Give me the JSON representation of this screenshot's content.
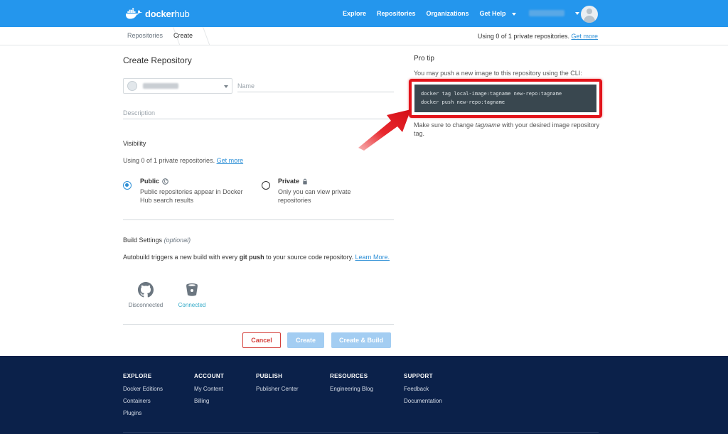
{
  "app": {
    "brand_bold": "docker",
    "brand_light": "hub"
  },
  "nav": {
    "links": [
      "Explore",
      "Repositories",
      "Organizations",
      "Get Help"
    ]
  },
  "breadcrumb": {
    "items": [
      "Repositories",
      "Create"
    ]
  },
  "usage": {
    "text": "Using 0 of 1 private repositories. ",
    "link": "Get more"
  },
  "form": {
    "title": "Create Repository",
    "name_placeholder": "Name",
    "description_placeholder": "Description",
    "visibility": {
      "label": "Visibility",
      "usage_text": "Using 0 of 1 private repositories. ",
      "usage_link": "Get more",
      "public": {
        "title": "Public",
        "desc": "Public repositories appear in Docker Hub search results",
        "selected": true
      },
      "private": {
        "title": "Private",
        "desc": "Only you can view private repositories",
        "selected": false
      }
    },
    "build": {
      "title": "Build Settings",
      "optional": "(optional)",
      "text_before": "Autobuild triggers a new build with every ",
      "text_bold": "git push",
      "text_after": " to your source code repository. ",
      "learn_more": "Learn More.",
      "providers": [
        {
          "name": "github",
          "status": "Disconnected",
          "color": "#6b7680"
        },
        {
          "name": "bitbucket",
          "status": "Connected",
          "color": "#2ea8c7"
        }
      ]
    },
    "buttons": {
      "cancel": "Cancel",
      "create": "Create",
      "create_build": "Create & Build"
    }
  },
  "protip": {
    "title": "Pro tip",
    "line": "You may push a new image to this repository using the CLI:",
    "code": [
      "docker tag local-image:tagname new-repo:tagname",
      "docker push new-repo:tagname"
    ],
    "note_before": "Make sure to change ",
    "note_em": "tagname",
    "note_after": " with your desired image repository tag."
  },
  "footer": {
    "columns": [
      {
        "heading": "EXPLORE",
        "items": [
          "Docker Editions",
          "Containers",
          "Plugins"
        ]
      },
      {
        "heading": "ACCOUNT",
        "items": [
          "My Content",
          "Billing"
        ]
      },
      {
        "heading": "PUBLISH",
        "items": [
          "Publisher Center"
        ]
      },
      {
        "heading": "RESOURCES",
        "items": [
          "Engineering Blog"
        ]
      },
      {
        "heading": "SUPPORT",
        "items": [
          "Feedback",
          "Documentation"
        ]
      }
    ]
  },
  "colors": {
    "nav": "#2496ed",
    "footer": "#0b214a",
    "accent": "#2d8fd6",
    "highlight": "#e2141b"
  }
}
